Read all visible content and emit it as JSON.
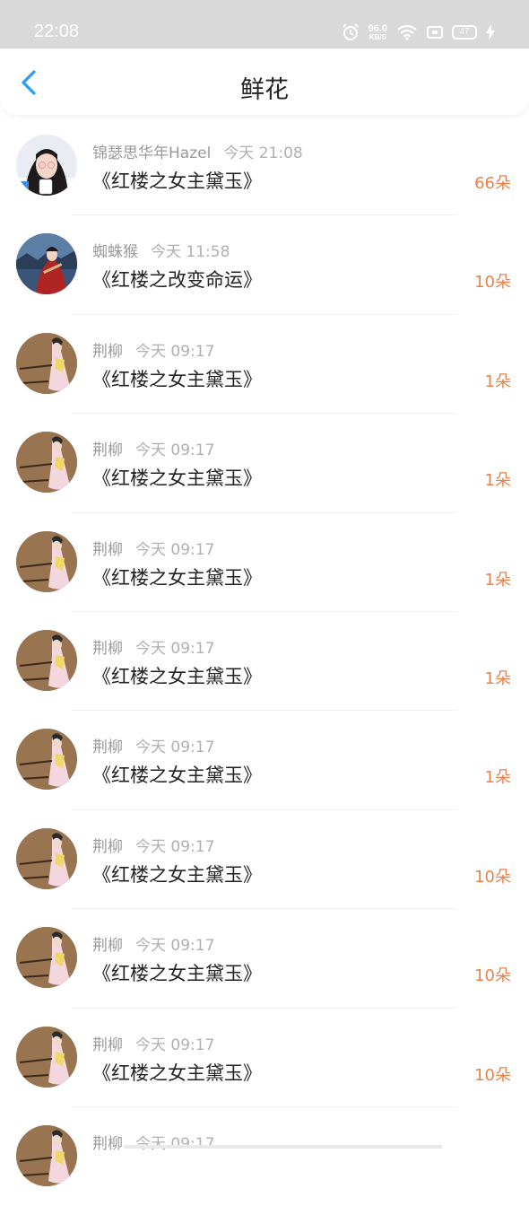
{
  "status_bar": {
    "time": "22:08",
    "net_speed": "96.0",
    "net_unit": "KB/S",
    "battery": "47"
  },
  "header": {
    "title": "鲜花"
  },
  "records": [
    {
      "user": "锦瑟思华年Hazel",
      "time": "今天 21:08",
      "book": "《红楼之女主黛玉》",
      "count": "66朵",
      "avatar": "girl-photo"
    },
    {
      "user": "蜘蛛猴",
      "time": "今天 11:58",
      "book": "《红楼之改变命运》",
      "count": "10朵",
      "avatar": "costume-photo"
    },
    {
      "user": "荆柳",
      "time": "今天 09:17",
      "book": "《红楼之女主黛玉》",
      "count": "1朵",
      "avatar": "painting"
    },
    {
      "user": "荆柳",
      "time": "今天 09:17",
      "book": "《红楼之女主黛玉》",
      "count": "1朵",
      "avatar": "painting"
    },
    {
      "user": "荆柳",
      "time": "今天 09:17",
      "book": "《红楼之女主黛玉》",
      "count": "1朵",
      "avatar": "painting"
    },
    {
      "user": "荆柳",
      "time": "今天 09:17",
      "book": "《红楼之女主黛玉》",
      "count": "1朵",
      "avatar": "painting"
    },
    {
      "user": "荆柳",
      "time": "今天 09:17",
      "book": "《红楼之女主黛玉》",
      "count": "1朵",
      "avatar": "painting"
    },
    {
      "user": "荆柳",
      "time": "今天 09:17",
      "book": "《红楼之女主黛玉》",
      "count": "10朵",
      "avatar": "painting"
    },
    {
      "user": "荆柳",
      "time": "今天 09:17",
      "book": "《红楼之女主黛玉》",
      "count": "10朵",
      "avatar": "painting"
    },
    {
      "user": "荆柳",
      "time": "今天 09:17",
      "book": "《红楼之女主黛玉》",
      "count": "10朵",
      "avatar": "painting"
    },
    {
      "user": "荆柳",
      "time": "今天 09:17",
      "book": "",
      "count": "",
      "avatar": "painting"
    }
  ],
  "colors": {
    "accent": "#e8824a",
    "back_arrow": "#2a9df4"
  }
}
